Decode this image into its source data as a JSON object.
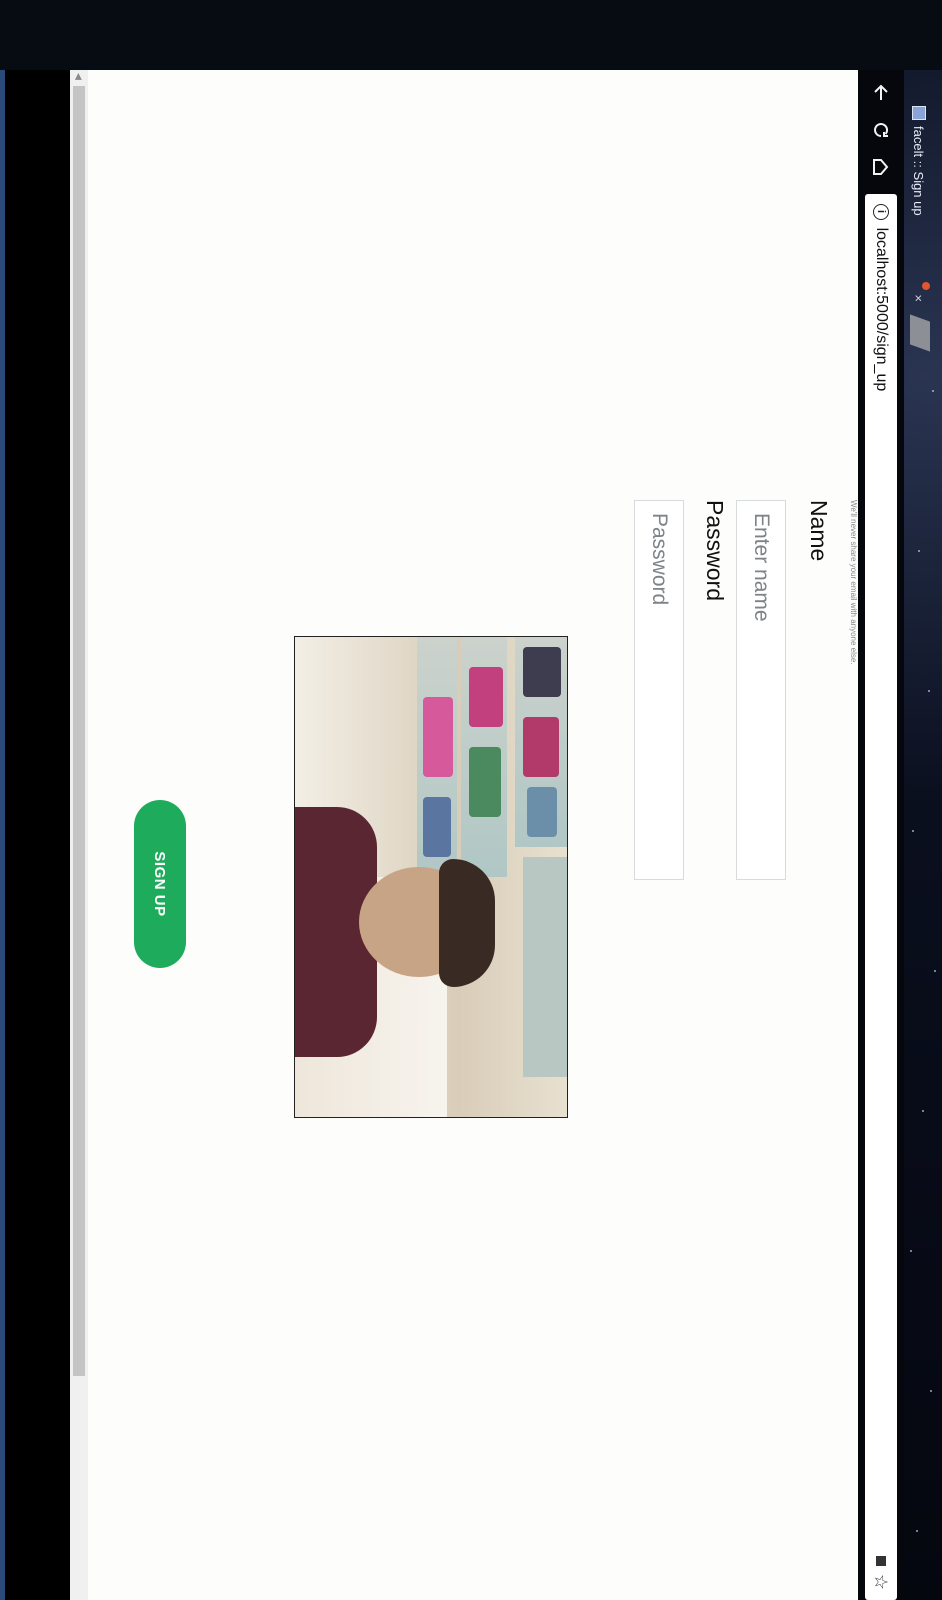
{
  "browser": {
    "tab_title": "facelt :: Sign up",
    "tab_close": "×",
    "url": "localhost:5000/sign_up",
    "back_icon": "arrow-left-icon",
    "reload_icon": "reload-icon",
    "home_icon": "home-icon",
    "bookmark_icon": "star-icon",
    "info_icon": "info-icon"
  },
  "form": {
    "email_hint": "We'll never share your email with anyone else.",
    "name_label": "Name",
    "name_placeholder": "Enter name",
    "password_label": "Password",
    "password_placeholder": "Password",
    "submit_label": "SIGN UP"
  },
  "colors": {
    "accent": "#1eac5c",
    "background": "#fdfdfb"
  }
}
